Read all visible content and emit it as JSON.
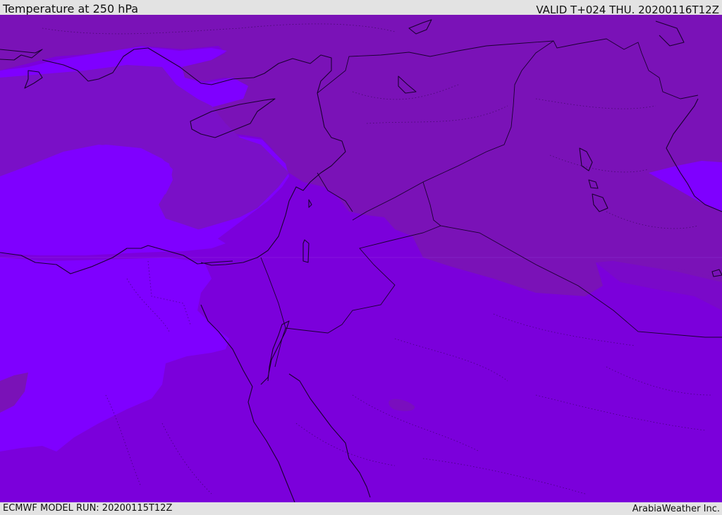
{
  "header": {
    "title": "Temperature at 250 hPa",
    "valid_time": "VALID T+024 THU. 20200116T12Z"
  },
  "footer": {
    "model_run": "ECMWF MODEL RUN: 20200115T12Z",
    "credit": "ArabiaWeather Inc."
  },
  "colors": {
    "fill_base": "#7b00db",
    "fill_cold": "#7f00ff",
    "fill_warm": "#7a12b7",
    "fill_mid": "#7a10c7",
    "coastline": "#1a0030",
    "frame": "#e3e3e3"
  }
}
